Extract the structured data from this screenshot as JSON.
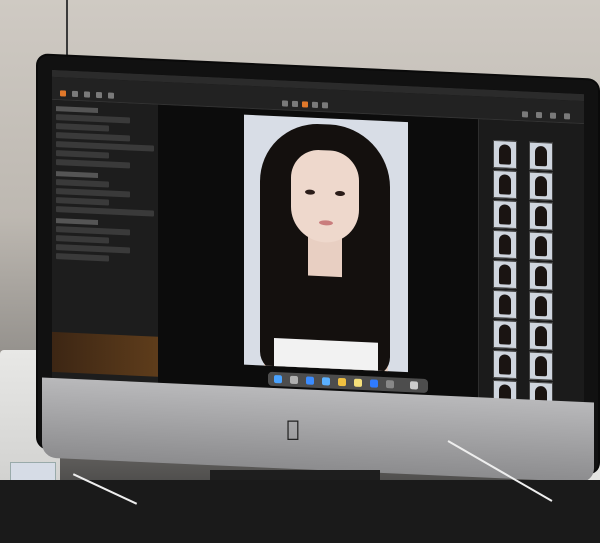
{
  "app": {
    "name": "",
    "window_title": ""
  },
  "scene": {
    "monitor_brand_mark": "apple-logo-icon",
    "colors": {
      "accent": "#e0782a",
      "ui_dark": "#1d1d1d",
      "photo_background": "#d8dde6"
    }
  },
  "thumbnails": {
    "count": 18
  },
  "dock": {
    "icons": [
      "finder-icon",
      "launchpad-icon",
      "safari-icon",
      "mail-icon",
      "photos-icon",
      "notes-icon",
      "app-store-icon",
      "settings-icon",
      "trash-icon"
    ]
  }
}
